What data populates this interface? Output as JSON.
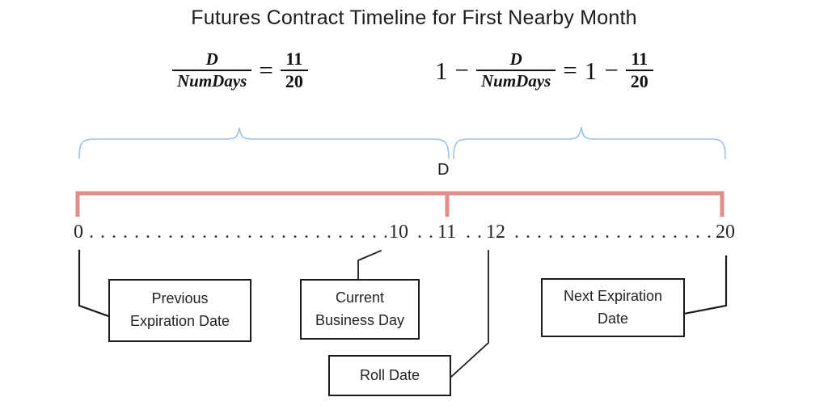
{
  "title": "Futures Contract Timeline for First Nearby Month",
  "colors": {
    "bracket": "#e08e87",
    "brace": "#9dc3e6",
    "line": "#1b1b1b",
    "text": "#1c1c1c",
    "background": "#ffffff"
  },
  "formulas": {
    "left": {
      "numerator": "D",
      "denominator": "NumDays",
      "equals": "=",
      "result_numerator": "11",
      "result_denominator": "20"
    },
    "right": {
      "one": "1",
      "minus": "−",
      "numerator": "D",
      "denominator": "NumDays",
      "equals": "=",
      "result_one": "1",
      "result_minus": "−",
      "result_numerator": "11",
      "result_denominator": "20"
    }
  },
  "span_label": "D",
  "axis": {
    "ticks": [
      "0",
      "10",
      "11",
      "12",
      "20"
    ],
    "leader_dots": ". . . . . . . . . . . . . . . . . . . . . . . . . . . . . . . . . . . . . . . ."
  },
  "callouts": [
    {
      "name": "previous-expiration-date",
      "lines": [
        "Previous",
        "Expiration Date"
      ]
    },
    {
      "name": "current-business-day",
      "lines": [
        "Current",
        "Business Day"
      ]
    },
    {
      "name": "roll-date",
      "lines": [
        "Roll Date"
      ]
    },
    {
      "name": "next-expiration-date",
      "lines": [
        "Next Expiration",
        "Date"
      ]
    }
  ]
}
